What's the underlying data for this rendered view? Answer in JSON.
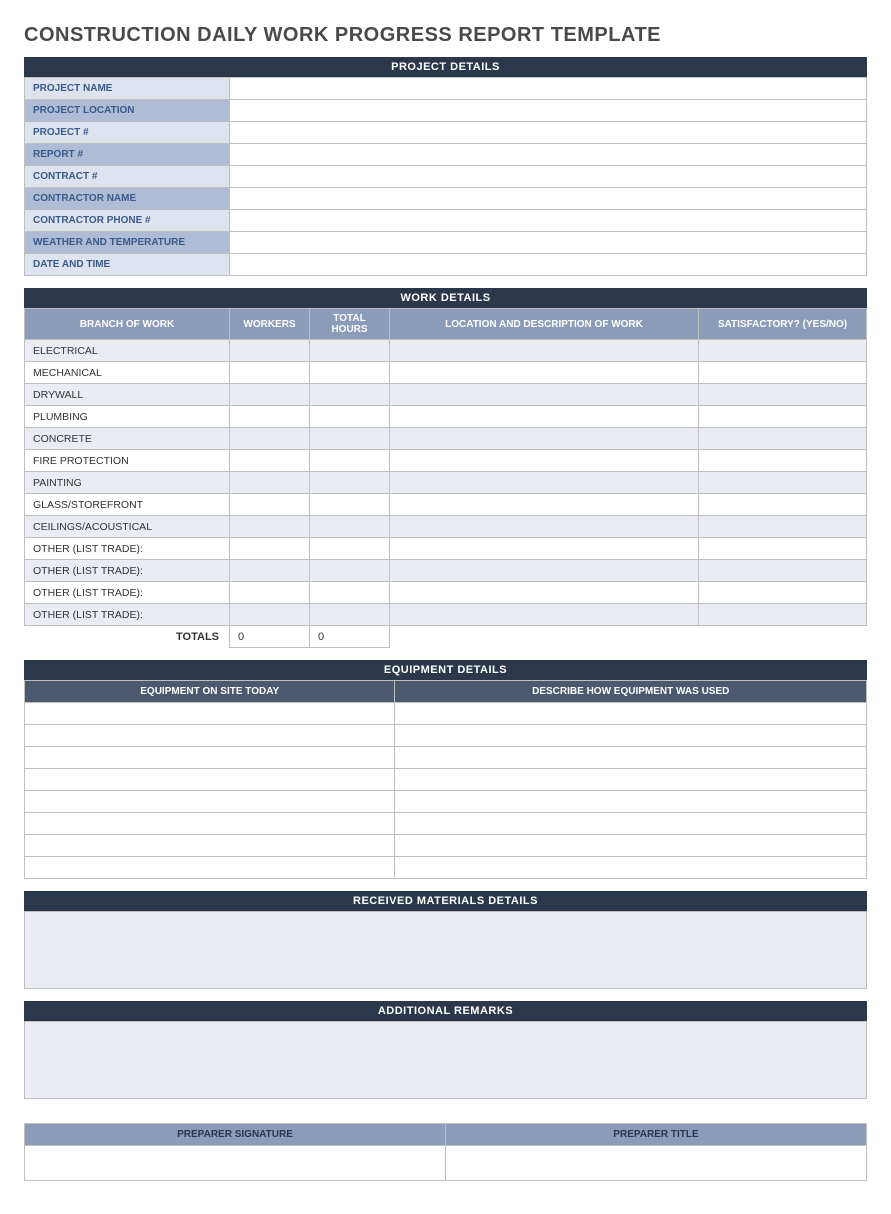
{
  "title": "CONSTRUCTION DAILY WORK PROGRESS REPORT TEMPLATE",
  "project_details": {
    "header": "PROJECT DETAILS",
    "rows": [
      {
        "label": "PROJECT NAME",
        "value": "",
        "shade": "light"
      },
      {
        "label": "PROJECT LOCATION",
        "value": "",
        "shade": "dark"
      },
      {
        "label": "PROJECT #",
        "value": "",
        "shade": "light"
      },
      {
        "label": "REPORT #",
        "value": "",
        "shade": "dark"
      },
      {
        "label": "CONTRACT #",
        "value": "",
        "shade": "light"
      },
      {
        "label": "CONTRACTOR NAME",
        "value": "",
        "shade": "dark"
      },
      {
        "label": "CONTRACTOR PHONE #",
        "value": "",
        "shade": "light"
      },
      {
        "label": "WEATHER AND TEMPERATURE",
        "value": "",
        "shade": "dark"
      },
      {
        "label": "DATE AND TIME",
        "value": "",
        "shade": "light"
      }
    ]
  },
  "work_details": {
    "header": "WORK DETAILS",
    "columns": {
      "branch": "BRANCH OF WORK",
      "workers": "WORKERS",
      "hours": "TOTAL HOURS",
      "location": "LOCATION AND DESCRIPTION OF WORK",
      "satisfactory": "SATISFACTORY? (YES/NO)"
    },
    "rows": [
      {
        "branch": "ELECTRICAL",
        "workers": "",
        "hours": "",
        "location": "",
        "satisfactory": ""
      },
      {
        "branch": "MECHANICAL",
        "workers": "",
        "hours": "",
        "location": "",
        "satisfactory": ""
      },
      {
        "branch": "DRYWALL",
        "workers": "",
        "hours": "",
        "location": "",
        "satisfactory": ""
      },
      {
        "branch": "PLUMBING",
        "workers": "",
        "hours": "",
        "location": "",
        "satisfactory": ""
      },
      {
        "branch": "CONCRETE",
        "workers": "",
        "hours": "",
        "location": "",
        "satisfactory": ""
      },
      {
        "branch": "FIRE PROTECTION",
        "workers": "",
        "hours": "",
        "location": "",
        "satisfactory": ""
      },
      {
        "branch": "PAINTING",
        "workers": "",
        "hours": "",
        "location": "",
        "satisfactory": ""
      },
      {
        "branch": "GLASS/STOREFRONT",
        "workers": "",
        "hours": "",
        "location": "",
        "satisfactory": ""
      },
      {
        "branch": "CEILINGS/ACOUSTICAL",
        "workers": "",
        "hours": "",
        "location": "",
        "satisfactory": ""
      },
      {
        "branch": "OTHER (LIST TRADE):",
        "workers": "",
        "hours": "",
        "location": "",
        "satisfactory": ""
      },
      {
        "branch": "OTHER (LIST TRADE):",
        "workers": "",
        "hours": "",
        "location": "",
        "satisfactory": ""
      },
      {
        "branch": "OTHER (LIST TRADE):",
        "workers": "",
        "hours": "",
        "location": "",
        "satisfactory": ""
      },
      {
        "branch": "OTHER (LIST TRADE):",
        "workers": "",
        "hours": "",
        "location": "",
        "satisfactory": ""
      }
    ],
    "totals_label": "TOTALS",
    "totals_workers": "0",
    "totals_hours": "0"
  },
  "equipment_details": {
    "header": "EQUIPMENT DETAILS",
    "columns": {
      "onsite": "EQUIPMENT ON SITE TODAY",
      "used": "DESCRIBE HOW EQUIPMENT WAS USED"
    },
    "rows": [
      {
        "onsite": "",
        "used": ""
      },
      {
        "onsite": "",
        "used": ""
      },
      {
        "onsite": "",
        "used": ""
      },
      {
        "onsite": "",
        "used": ""
      },
      {
        "onsite": "",
        "used": ""
      },
      {
        "onsite": "",
        "used": ""
      },
      {
        "onsite": "",
        "used": ""
      },
      {
        "onsite": "",
        "used": ""
      }
    ]
  },
  "received_materials": {
    "header": "RECEIVED MATERIALS DETAILS",
    "value": ""
  },
  "additional_remarks": {
    "header": "ADDITIONAL REMARKS",
    "value": ""
  },
  "signature": {
    "columns": {
      "sig": "PREPARER SIGNATURE",
      "title": "PREPARER TITLE"
    },
    "sig_value": "",
    "title_value": ""
  }
}
